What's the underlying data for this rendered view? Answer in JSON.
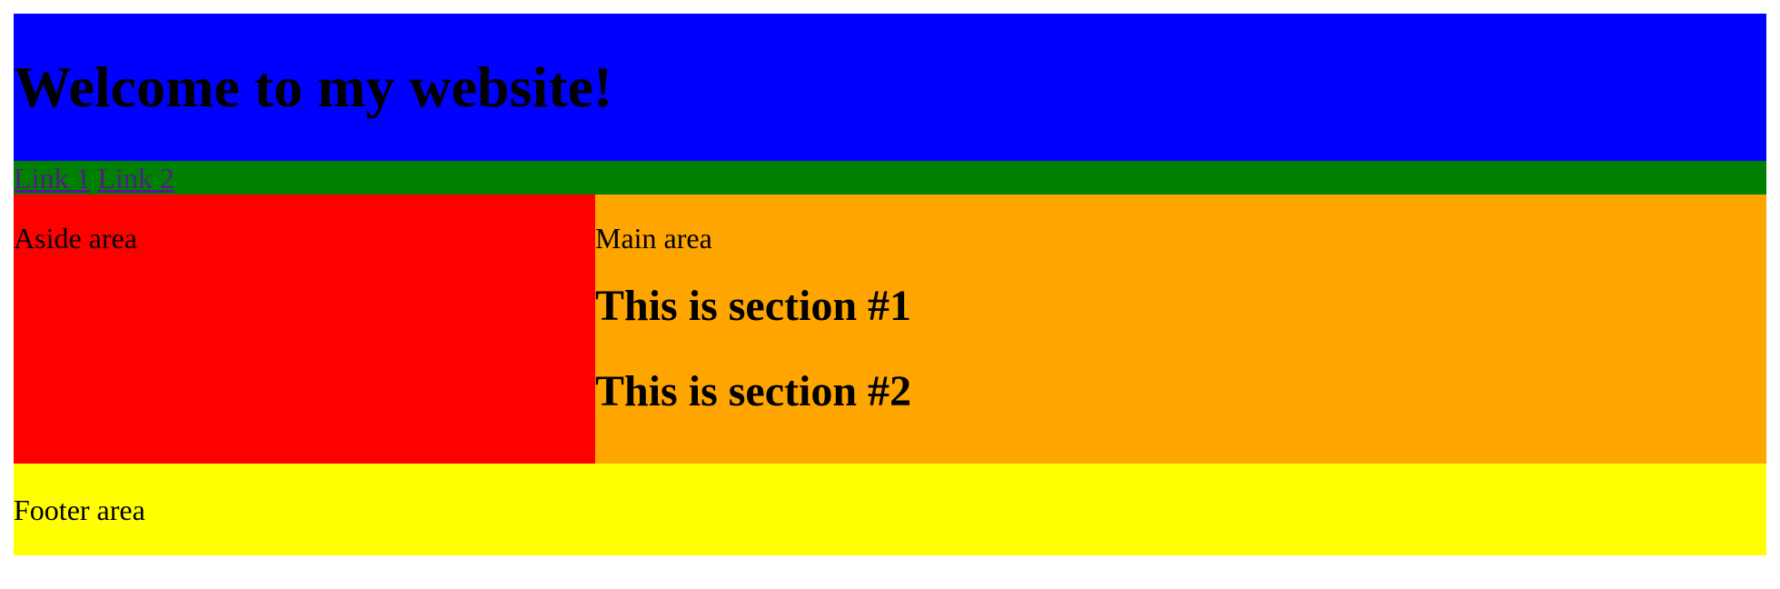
{
  "header": {
    "title": "Welcome to my website!",
    "background": "#0000ff"
  },
  "nav": {
    "background": "#008000",
    "link_color": "#551a8b",
    "links": [
      {
        "label": "Link 1"
      },
      {
        "label": "Link 2"
      }
    ]
  },
  "aside": {
    "text": "Aside area",
    "background": "#ff0000"
  },
  "main": {
    "text": "Main area",
    "background": "#ffa500",
    "sections": [
      {
        "title": "This is section #1"
      },
      {
        "title": "This is section #2"
      }
    ]
  },
  "footer": {
    "text": "Footer area",
    "background": "#ffff00"
  }
}
